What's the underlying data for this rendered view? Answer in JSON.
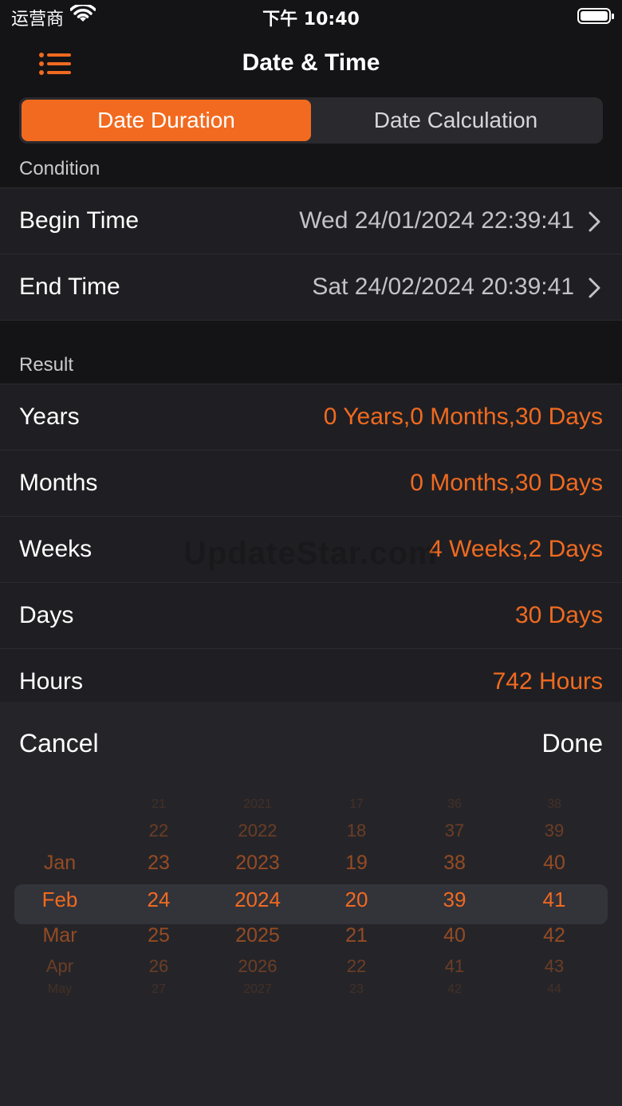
{
  "status": {
    "carrier": "运营商",
    "time": "下午 10:40"
  },
  "nav": {
    "title": "Date & Time"
  },
  "segments": [
    {
      "label": "Date Duration",
      "active": true
    },
    {
      "label": "Date Calculation",
      "active": false
    }
  ],
  "condition": {
    "header": "Condition",
    "rows": [
      {
        "label": "Begin Time",
        "value": "Wed 24/01/2024 22:39:41"
      },
      {
        "label": "End Time",
        "value": "Sat 24/02/2024 20:39:41"
      }
    ]
  },
  "result": {
    "header": "Result",
    "rows": [
      {
        "label": "Years",
        "value": "0 Years,0 Months,30 Days"
      },
      {
        "label": "Months",
        "value": "0 Months,30 Days"
      },
      {
        "label": "Weeks",
        "value": "4 Weeks,2 Days"
      },
      {
        "label": "Days",
        "value": "30 Days"
      },
      {
        "label": "Hours",
        "value": "742 Hours"
      }
    ]
  },
  "watermark": "UpdateStar.com",
  "picker": {
    "cancel": "Cancel",
    "done": "Done",
    "accent_color": "#f06a20",
    "columns": [
      {
        "name": "month",
        "items": [
          "",
          "",
          "Jan",
          "Feb",
          "Mar",
          "Apr",
          "May"
        ]
      },
      {
        "name": "day",
        "items": [
          "21",
          "22",
          "23",
          "24",
          "25",
          "26",
          "27"
        ]
      },
      {
        "name": "year",
        "items": [
          "2021",
          "2022",
          "2023",
          "2024",
          "2025",
          "2026",
          "2027"
        ]
      },
      {
        "name": "hour",
        "items": [
          "17",
          "18",
          "19",
          "20",
          "21",
          "22",
          "23"
        ]
      },
      {
        "name": "minute",
        "items": [
          "36",
          "37",
          "38",
          "39",
          "40",
          "41",
          "42"
        ]
      },
      {
        "name": "second",
        "items": [
          "38",
          "39",
          "40",
          "41",
          "42",
          "43",
          "44"
        ]
      }
    ]
  }
}
